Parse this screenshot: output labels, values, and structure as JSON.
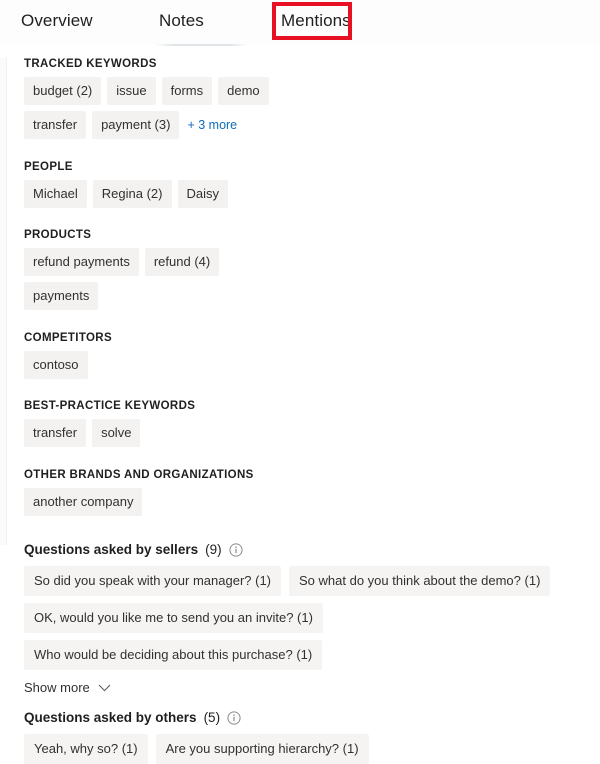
{
  "tabs": [
    {
      "label": "Overview",
      "selected": false
    },
    {
      "label": "Notes",
      "selected": true
    },
    {
      "label": "Mentions",
      "selected": false
    }
  ],
  "highlight": {
    "color": "#e81123",
    "target": "Mentions"
  },
  "accent_color": "#0f6cbd",
  "chip_background": "#f3f2f1",
  "sections": [
    {
      "title": "TRACKED KEYWORDS",
      "chips": [
        "budget (2)",
        "issue",
        "forms",
        "demo",
        "transfer",
        "payment (3)"
      ],
      "more_label": "+ 3 more"
    },
    {
      "title": "PEOPLE",
      "chips": [
        "Michael",
        "Regina (2)",
        "Daisy"
      ],
      "more_label": ""
    },
    {
      "title": "PRODUCTS",
      "chips": [
        "refund payments",
        "refund (4)",
        "payments"
      ],
      "more_label": ""
    },
    {
      "title": "COMPETITORS",
      "chips": [
        "contoso"
      ],
      "more_label": ""
    },
    {
      "title": "BEST-PRACTICE KEYWORDS",
      "chips": [
        "transfer",
        "solve"
      ],
      "more_label": ""
    },
    {
      "title": "OTHER BRANDS AND ORGANIZATIONS",
      "chips": [
        "another company"
      ],
      "more_label": ""
    }
  ],
  "question_groups": [
    {
      "title": "Questions asked by sellers",
      "count": "(9)",
      "info_icon": "info-circle-icon",
      "chips": [
        "So did you speak with your manager? (1)",
        "So what do you think about the demo? (1)",
        "OK, would you like me to send you an invite? (1)",
        "Who would be deciding about this purchase? (1)"
      ],
      "show_more_label": "Show more",
      "chevron_icon": "chevron-down-icon"
    },
    {
      "title": "Questions asked by others",
      "count": "(5)",
      "info_icon": "info-circle-icon",
      "chips": [
        "Yeah, why so? (1)",
        "Are you supporting hierarchy? (1)"
      ],
      "show_more_label": "",
      "chevron_icon": ""
    }
  ]
}
